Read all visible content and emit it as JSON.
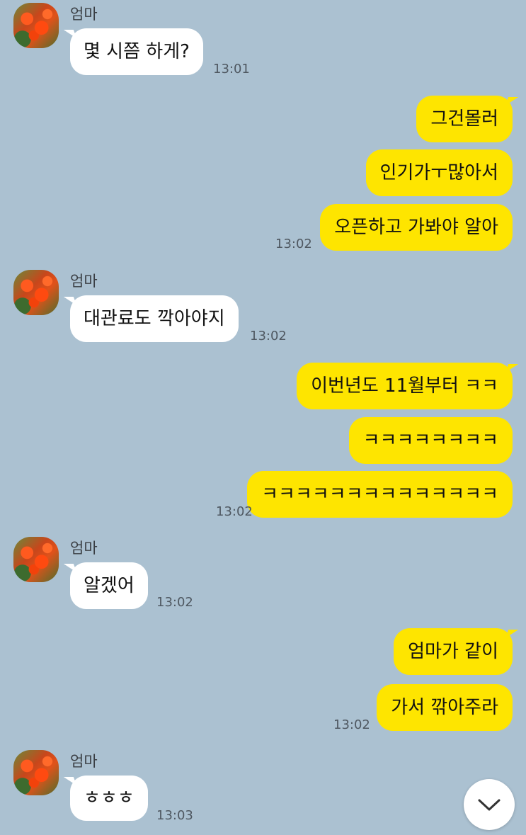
{
  "sender_name": "엄마",
  "icons": {
    "avatar": "flower-avatar-icon",
    "scroll": "chevron-down-icon"
  },
  "colors": {
    "background": "#abc1d1",
    "outgoing_bubble": "#fee500",
    "incoming_bubble": "#ffffff"
  },
  "messages": {
    "m1": {
      "text": "몇 시쯤 하게?",
      "time": "13:01"
    },
    "m2": {
      "text": "그건몰러"
    },
    "m3": {
      "text": "인기가ㅜ많아서"
    },
    "m4": {
      "text": "오픈하고 가봐야 알아",
      "time": "13:02"
    },
    "m5": {
      "text": "대관료도 깍아야지",
      "time": "13:02"
    },
    "m6": {
      "text": "이번년도 11월부터 ㅋㅋ"
    },
    "m7": {
      "text": "ㅋㅋㅋㅋㅋㅋㅋㅋ"
    },
    "m8": {
      "text": "ㅋㅋㅋㅋㅋㅋㅋㅋㅋㅋㅋㅋㅋㅋ",
      "time": "13:02"
    },
    "m9": {
      "text": "알겠어",
      "time": "13:02"
    },
    "m10": {
      "text": "엄마가 같이"
    },
    "m11": {
      "text": "가서 깎아주라",
      "time": "13:02"
    },
    "m12": {
      "text": "ㅎㅎㅎ",
      "time": "13:03"
    }
  }
}
